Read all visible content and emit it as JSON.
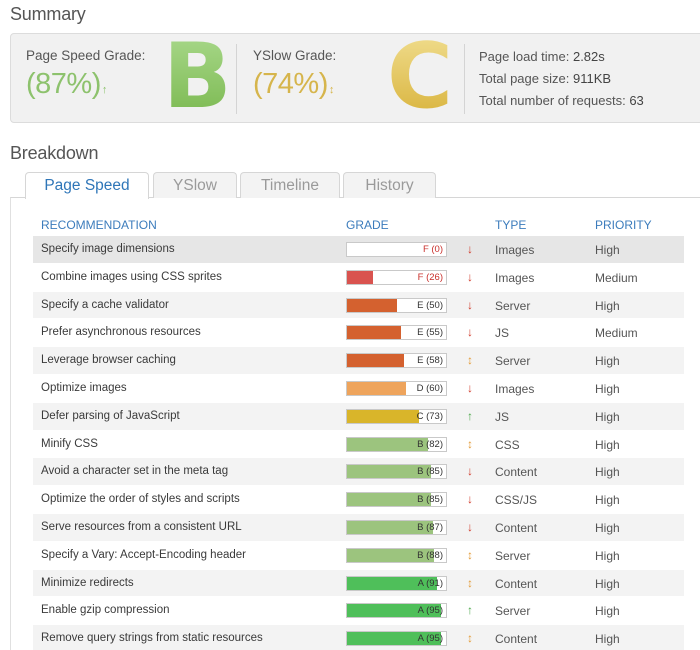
{
  "summary": {
    "title": "Summary",
    "pagespeed": {
      "label": "Page Speed Grade:",
      "percent": "(87%)",
      "arrow": "↑",
      "letter": "B"
    },
    "yslow": {
      "label": "YSlow Grade:",
      "percent": "(74%)",
      "arrow": "↕",
      "letter": "C"
    },
    "stats": [
      {
        "label": "Page load time:",
        "value": "2.82s"
      },
      {
        "label": "Total page size:",
        "value": "911KB"
      },
      {
        "label": "Total number of requests:",
        "value": "63"
      }
    ]
  },
  "breakdown": {
    "title": "Breakdown",
    "tabs": [
      {
        "label": "Page Speed",
        "active": true
      },
      {
        "label": "YSlow",
        "active": false
      },
      {
        "label": "Timeline",
        "active": false
      },
      {
        "label": "History",
        "active": false
      }
    ],
    "columns": {
      "recommendation": "RECOMMENDATION",
      "grade": "GRADE",
      "type": "TYPE",
      "priority": "PRIORITY"
    },
    "rows": [
      {
        "rec": "Specify image dimensions",
        "grade": "F (0)",
        "score": 0,
        "trend": "down",
        "type": "Images",
        "priority": "High"
      },
      {
        "rec": "Combine images using CSS sprites",
        "grade": "F (26)",
        "score": 26,
        "trend": "down",
        "type": "Images",
        "priority": "Medium"
      },
      {
        "rec": "Specify a cache validator",
        "grade": "E (50)",
        "score": 50,
        "trend": "down",
        "type": "Server",
        "priority": "High"
      },
      {
        "rec": "Prefer asynchronous resources",
        "grade": "E (55)",
        "score": 55,
        "trend": "down",
        "type": "JS",
        "priority": "Medium"
      },
      {
        "rec": "Leverage browser caching",
        "grade": "E (58)",
        "score": 58,
        "trend": "neutral",
        "type": "Server",
        "priority": "High"
      },
      {
        "rec": "Optimize images",
        "grade": "D (60)",
        "score": 60,
        "trend": "down",
        "type": "Images",
        "priority": "High"
      },
      {
        "rec": "Defer parsing of JavaScript",
        "grade": "C (73)",
        "score": 73,
        "trend": "up",
        "type": "JS",
        "priority": "High"
      },
      {
        "rec": "Minify CSS",
        "grade": "B (82)",
        "score": 82,
        "trend": "neutral",
        "type": "CSS",
        "priority": "High"
      },
      {
        "rec": "Avoid a character set in the meta tag",
        "grade": "B (85)",
        "score": 85,
        "trend": "down",
        "type": "Content",
        "priority": "High"
      },
      {
        "rec": "Optimize the order of styles and scripts",
        "grade": "B (85)",
        "score": 85,
        "trend": "down",
        "type": "CSS/JS",
        "priority": "High"
      },
      {
        "rec": "Serve resources from a consistent URL",
        "grade": "B (87)",
        "score": 87,
        "trend": "down",
        "type": "Content",
        "priority": "High"
      },
      {
        "rec": "Specify a Vary: Accept-Encoding header",
        "grade": "B (88)",
        "score": 88,
        "trend": "neutral",
        "type": "Server",
        "priority": "High"
      },
      {
        "rec": "Minimize redirects",
        "grade": "A (91)",
        "score": 91,
        "trend": "neutral",
        "type": "Content",
        "priority": "High"
      },
      {
        "rec": "Enable gzip compression",
        "grade": "A (95)",
        "score": 95,
        "trend": "up",
        "type": "Server",
        "priority": "High"
      },
      {
        "rec": "Remove query strings from static resources",
        "grade": "A (95)",
        "score": 95,
        "trend": "neutral",
        "type": "Content",
        "priority": "High"
      }
    ]
  },
  "colors": {
    "F": "#d9534f",
    "E": "#d4612f",
    "D": "#eea45c",
    "C": "#d9b52a",
    "B": "#9cc47e",
    "A": "#4fbf5a",
    "trend_down": "#d03a2a",
    "trend_up": "#4ca84a",
    "trend_neutral": "#e39a35",
    "accent": "#2f76b8"
  }
}
